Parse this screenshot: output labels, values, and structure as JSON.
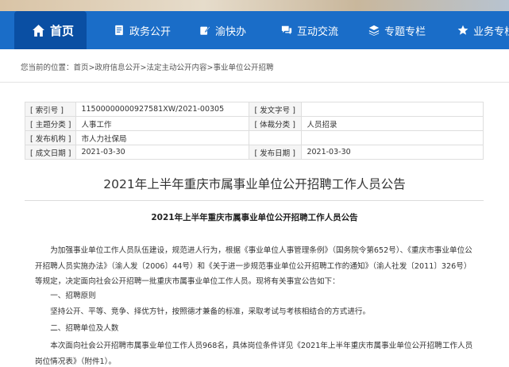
{
  "nav": {
    "items": [
      {
        "label": "首页",
        "icon": "home-icon"
      },
      {
        "label": "政务公开",
        "icon": "document-icon"
      },
      {
        "label": "渝快办",
        "icon": "edit-icon"
      },
      {
        "label": "互动交流",
        "icon": "chat-icon"
      },
      {
        "label": "专题专栏",
        "icon": "layers-icon"
      },
      {
        "label": "业务专栏",
        "icon": "star-icon"
      }
    ],
    "bg_color": "#1a6dc8",
    "active_color": "#0a4fa3"
  },
  "breadcrumb": {
    "prefix": "您当前的位置：",
    "items": [
      "首页",
      "政府信息公开",
      "法定主动公开内容",
      "事业单位公开招聘"
    ],
    "separator": ">"
  },
  "meta": {
    "index_no_label": "[ 索引号 ]",
    "index_no_value": "11500000000927581XW/2021-00305",
    "doc_no_label": "[ 发文字号 ]",
    "doc_no_value": "",
    "topic_label": "[ 主题分类 ]",
    "topic_value": "人事工作",
    "genre_label": "[ 体裁分类 ]",
    "genre_value": "人员招录",
    "issuer_label": "[ 发布机构 ]",
    "issuer_value": "市人力社保局",
    "created_label": "[ 成文日期 ]",
    "created_value": "2021-03-30",
    "published_label": "[ 发布日期 ]",
    "published_value": "2021-03-30"
  },
  "article": {
    "title": "2021年上半年重庆市属事业单位公开招聘工作人员公告",
    "subtitle": "2021年上半年重庆市属事业单位公开招聘工作人员公告",
    "para1": "为加强事业单位工作人员队伍建设，规范进人行为，根据《事业单位人事管理条例》（国务院令第652号）、《重庆市事业单位公开招聘人员实施办法》（渝人发〔2006〕44号）和《关于进一步规范事业单位公开招聘工作的通知》（渝人社发〔2011〕326号）等规定，决定面向社会公开招聘一批重庆市属事业单位工作人员。现将有关事宜公告如下：",
    "heading1": "一、招聘原则",
    "para2": "坚持公开、平等、竞争、择优方针，按照德才兼备的标准，采取考试与考核相结合的方式进行。",
    "heading2": "二、招聘单位及人数",
    "para3": "本次面向社会公开招聘市属事业单位工作人员968名，具体岗位条件详见《2021年上半年重庆市属事业单位公开招聘工作人员岗位情况表》（附件1）。"
  }
}
